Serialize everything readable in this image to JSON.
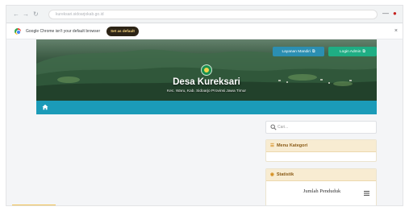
{
  "browser": {
    "omnibox_text": "kureksari.sidoarjokab.go.id",
    "infobar": {
      "message": "Google Chrome isn't your default browser",
      "set_default_label": "Set as default",
      "close_glyph": "×"
    },
    "nav_glyphs": {
      "back": "←",
      "forward": "→",
      "reload": "↻"
    },
    "window_glyphs": {
      "minimize": "—",
      "close": "●"
    }
  },
  "header": {
    "layanan_mandiri_label": "Layanan Mandiri",
    "login_admin_label": "Login Admin",
    "title": "Desa Kureksari",
    "subtitle": "Kec. Waru, Kab. Sidoarjo Provinsi Jawa Timur"
  },
  "nav": {
    "home_icon": "home-icon"
  },
  "sidebar": {
    "search_placeholder": "Cari...",
    "menu_kategori": {
      "title": "Menu Kategori",
      "icon_glyph": "☰"
    },
    "statistik": {
      "title": "Statistik",
      "icon_glyph": "◉",
      "item_label": "Jumlah Penduduk"
    }
  },
  "colors": {
    "nav_bar": "#1b9bb8",
    "layanan_button": "#2b8fb2",
    "login_button": "#1fae84",
    "widget_header_bg": "#f8ecd2",
    "widget_header_text": "#8a5b17",
    "set_default_bg": "#2d2416",
    "set_default_text": "#f5d27a"
  }
}
